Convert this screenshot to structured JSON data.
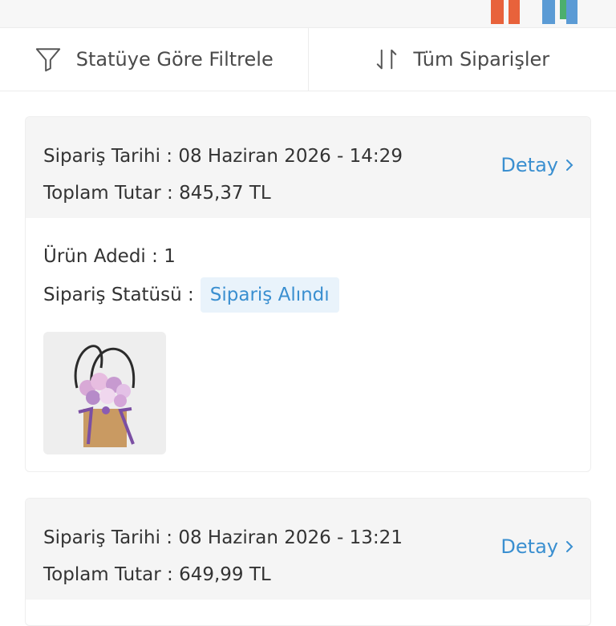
{
  "filters": {
    "status_filter_label": "Statüye Göre Filtrele",
    "sort_label": "Tüm Siparişler"
  },
  "orders": [
    {
      "date_text": "Sipariş Tarihi : 08 Haziran 2026 - 14:29",
      "total_text": "Toplam Tutar : 845,37 TL",
      "detail_label": "Detay",
      "quantity_text": "Ürün Adedi : 1",
      "status_label": "Sipariş Statüsü :",
      "status_value": "Sipariş Alındı"
    },
    {
      "date_text": "Sipariş Tarihi : 08 Haziran 2026 - 13:21",
      "total_text": "Toplam Tutar : 649,99 TL",
      "detail_label": "Detay"
    }
  ],
  "colors": {
    "accent": "#3a8fd0",
    "card_header_bg": "#f5f5f5",
    "status_badge_bg": "#e9f3fb"
  }
}
